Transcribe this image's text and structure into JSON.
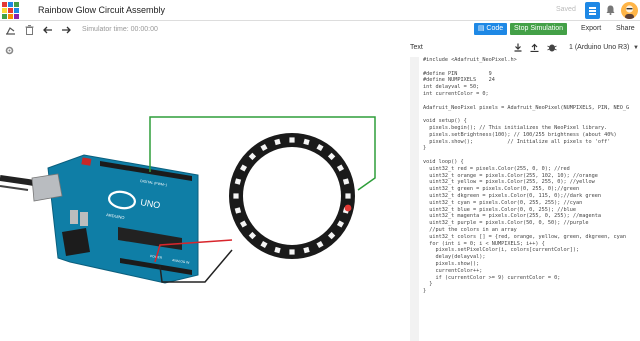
{
  "app": {
    "title": "Rainbow Glow Circuit Assembly",
    "save_status": "Saved",
    "logo_letters": [
      "T",
      "I",
      "N",
      "K",
      "E",
      "R",
      "C",
      "A",
      "D"
    ]
  },
  "toolbar": {
    "simulator_time": "Simulator time: 00:00:00",
    "code_label": "Code",
    "stop_label": "Stop Simulation",
    "export_label": "Export",
    "share_label": "Share"
  },
  "code_panel": {
    "mode": "Text",
    "device": "1 (Arduino Uno R3)",
    "code_lines": [
      "#include <Adafruit_NeoPixel.h>",
      "",
      "#define PIN          9",
      "#define NUMPIXELS    24",
      "int delayval = 50;",
      "int currentColor = 0;",
      "",
      "Adafruit_NeoPixel pixels = Adafruit_NeoPixel(NUMPIXELS, PIN, NEO_G",
      "",
      "void setup() {",
      "  pixels.begin(); // This initializes the NeoPixel library.",
      "  pixels.setBrightness(100); // 100/255 brightness (about 40%)",
      "  pixels.show();           // Initialize all pixels to 'off'",
      "}",
      "",
      "void loop() {",
      "  uint32_t red = pixels.Color(255, 0, 0); //red",
      "  uint32_t orange = pixels.Color(255, 102, 10); //orange",
      "  uint32_t yellow = pixels.Color(255, 255, 0); //yellow",
      "  uint32_t green = pixels.Color(0, 255, 0);//green",
      "  uint32_t dkgreen = pixels.Color(0, 115, 0);//dark green",
      "  uint32_t cyan = pixels.Color(0, 255, 255); //cyan",
      "  uint32_t blue = pixels.Color(0, 0, 255); //blue",
      "  uint32_t magenta = pixels.Color(255, 0, 255); //magenta",
      "  uint32_t purple = pixels.Color(50, 0, 50); //purple",
      "  //put the colors in an array",
      "  uint32_t colors [] = {red, orange, yellow, green, dkgreen, cyan",
      "  for (int i = 0; i < NUMPIXELS; i++) {",
      "    pixels.setPixelColor(i, colors[currentColor]);",
      "    delay(delayval);",
      "    pixels.show();",
      "    currentColor++;",
      "    if (currentColor >= 9) currentColor = 0;",
      "  }",
      "}"
    ]
  },
  "circuit": {
    "board_label": "UNO",
    "board_brand": "ARDUINO",
    "digital_label": "DIGITAL (PWM~)",
    "power_label": "POWER",
    "analog_label": "ANALOG IN",
    "neopixel_count": 24,
    "wire_colors": {
      "green": "#2e9e3a",
      "red": "#d8262c",
      "black": "#222222"
    }
  }
}
